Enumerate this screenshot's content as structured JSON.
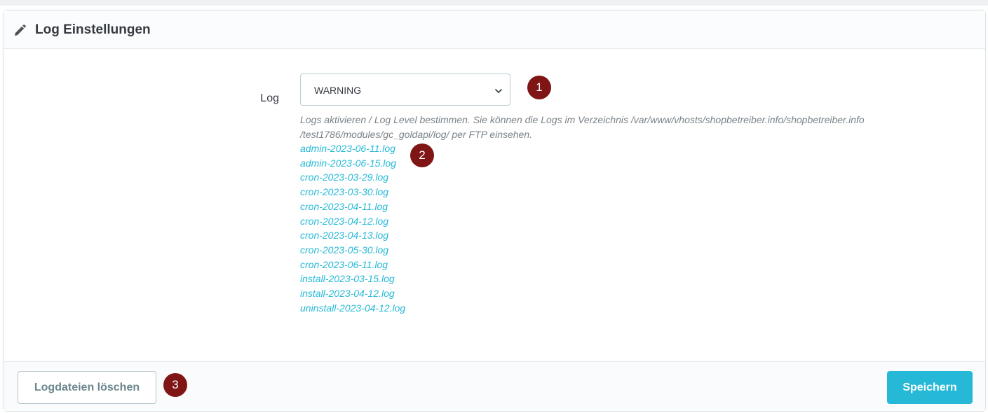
{
  "panel": {
    "title": "Log Einstellungen",
    "icon": "pencil-icon"
  },
  "log_field": {
    "label": "Log",
    "selected_value": "WARNING"
  },
  "help_text": {
    "line1": "Logs aktivieren / Log Level bestimmen. Sie können die Logs im Verzeichnis /var/www/vhosts/shopbetreiber.info/shopbetreiber.info",
    "line2": "/test1786/modules/gc_goldapi/log/ per FTP einsehen."
  },
  "log_files": [
    "admin-2023-06-11.log",
    "admin-2023-06-15.log",
    "cron-2023-03-29.log",
    "cron-2023-03-30.log",
    "cron-2023-04-11.log",
    "cron-2023-04-12.log",
    "cron-2023-04-13.log",
    "cron-2023-05-30.log",
    "cron-2023-06-11.log",
    "install-2023-03-15.log",
    "install-2023-04-12.log",
    "uninstall-2023-04-12.log"
  ],
  "badges": {
    "b1": "1",
    "b2": "2",
    "b3": "3"
  },
  "footer": {
    "delete_label": "Logdateien löschen",
    "save_label": "Speichern"
  },
  "colors": {
    "accent": "#25b9d7",
    "badge": "#7f1515",
    "text": "#363a41",
    "help_text": "#7a8288"
  }
}
